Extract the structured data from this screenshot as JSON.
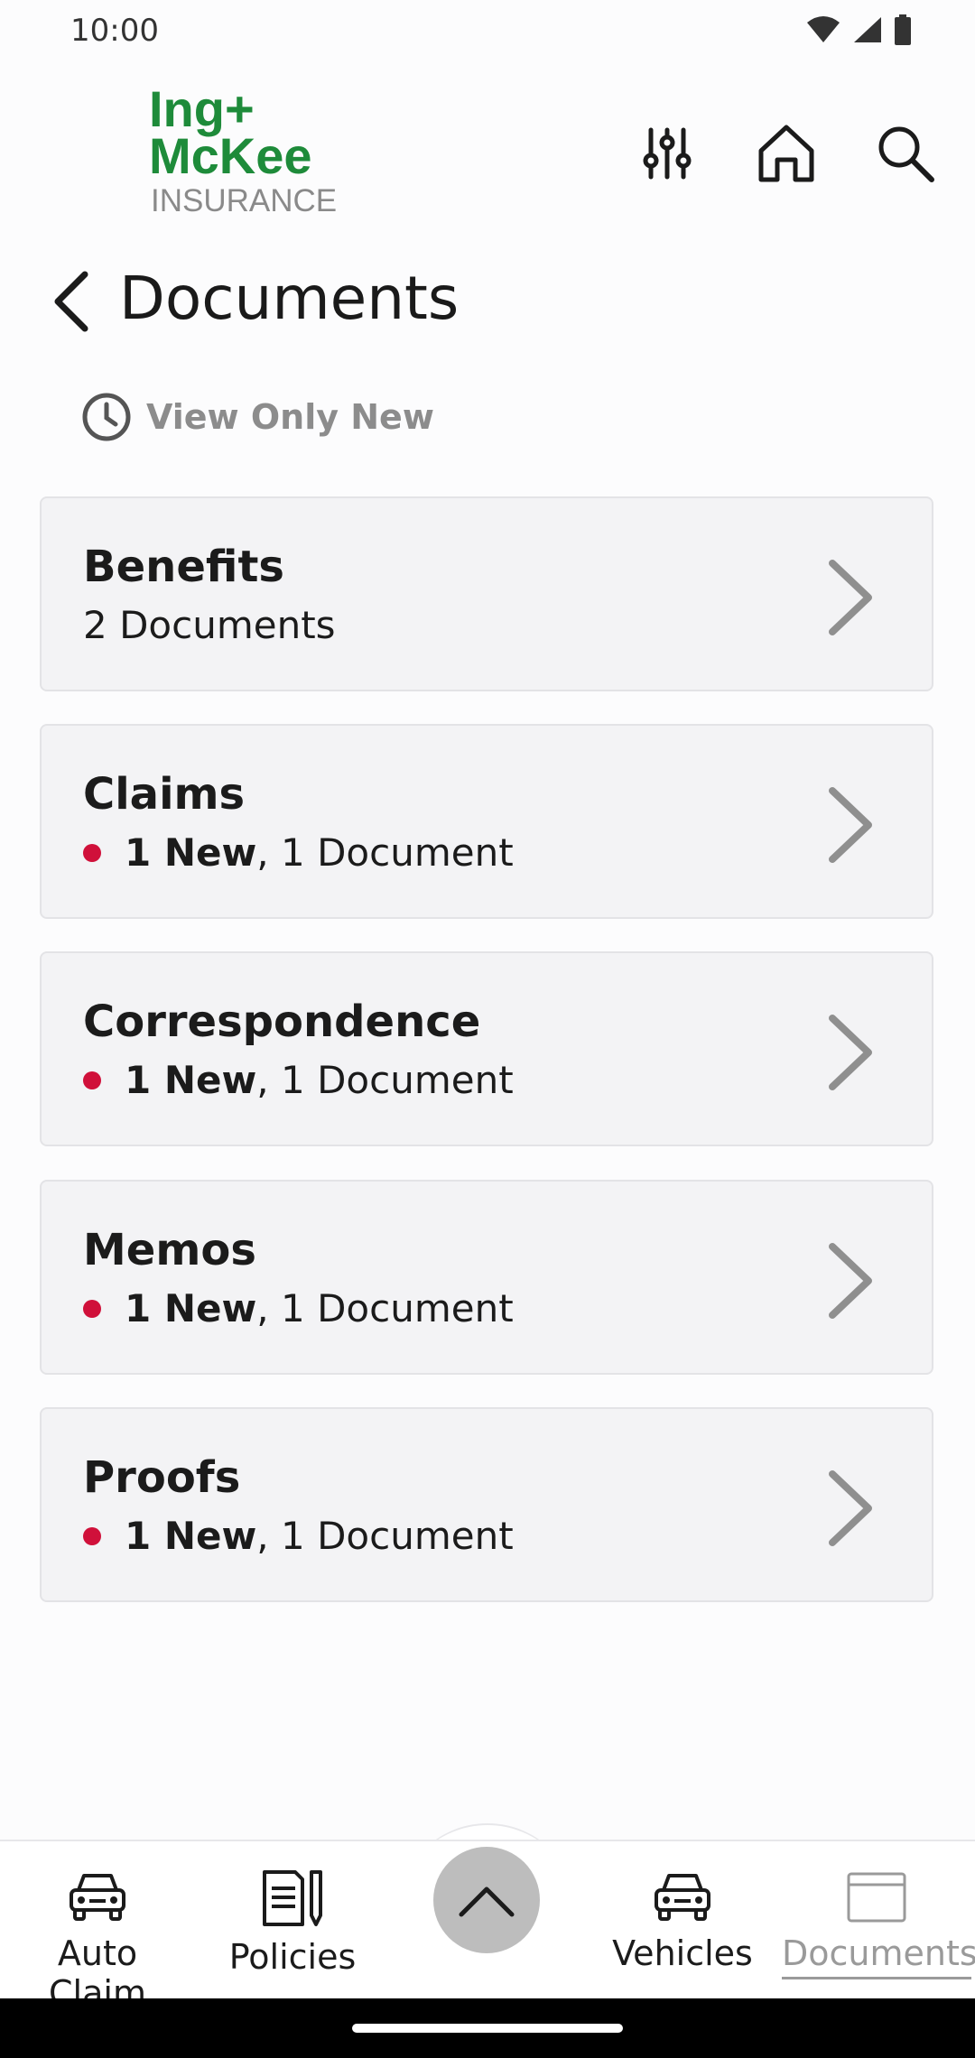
{
  "status": {
    "time": "10:00"
  },
  "header": {
    "logo": {
      "line1": "Ing+",
      "line2": "McKee",
      "line3": "INSURANCE"
    },
    "filter_icon": "sliders-icon",
    "home_icon": "home-icon",
    "search_icon": "search-icon"
  },
  "page": {
    "title": "Documents"
  },
  "filter": {
    "label": "View Only New",
    "icon": "clock-icon"
  },
  "cards": [
    {
      "title": "Benefits",
      "has_new": false,
      "new_text": "",
      "count_text": "2 Documents"
    },
    {
      "title": "Claims",
      "has_new": true,
      "new_text": "1 New",
      "count_text": ", 1 Document"
    },
    {
      "title": "Correspondence",
      "has_new": true,
      "new_text": "1 New",
      "count_text": ", 1 Document"
    },
    {
      "title": "Memos",
      "has_new": true,
      "new_text": "1 New",
      "count_text": ", 1 Document"
    },
    {
      "title": "Proofs",
      "has_new": true,
      "new_text": "1 New",
      "count_text": ", 1 Document"
    }
  ],
  "tabs": [
    {
      "label": "Auto Claim",
      "icon": "car-icon"
    },
    {
      "label": "Policies",
      "icon": "document-pen-icon"
    },
    {
      "label": "Vehicles",
      "icon": "car-icon"
    },
    {
      "label": "Documents",
      "icon": "folder-icon",
      "active": true
    }
  ],
  "colors": {
    "brand_green": "#1e8b3a",
    "new_dot": "#d0103a",
    "card_bg": "#f3f3f5"
  }
}
